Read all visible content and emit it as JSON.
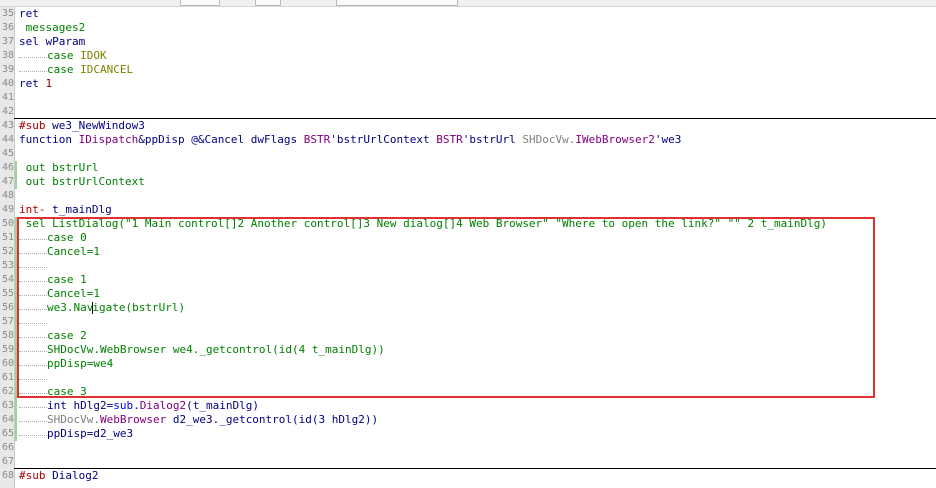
{
  "editor": {
    "lines": [
      {
        "num": "35",
        "indent": 0,
        "parts": [
          [
            "b",
            "ret"
          ]
        ]
      },
      {
        "num": "36",
        "indent": 0,
        "parts": [
          [
            "g",
            " messages2"
          ]
        ]
      },
      {
        "num": "37",
        "indent": 0,
        "parts": [
          [
            "b",
            "sel wParam"
          ]
        ]
      },
      {
        "num": "38",
        "indent": 1,
        "parts": [
          [
            "g",
            "case "
          ],
          [
            "c",
            "IDOK"
          ]
        ]
      },
      {
        "num": "39",
        "indent": 1,
        "parts": [
          [
            "g",
            "case "
          ],
          [
            "c",
            "IDCANCEL"
          ]
        ]
      },
      {
        "num": "40",
        "indent": 0,
        "parts": [
          [
            "b",
            "ret "
          ],
          [
            "n",
            "1"
          ]
        ]
      },
      {
        "num": "41",
        "indent": 0,
        "parts": []
      },
      {
        "num": "42",
        "indent": 0,
        "parts": []
      },
      {
        "num": "43",
        "indent": 0,
        "sep": true,
        "parts": [
          [
            "r",
            "#sub "
          ],
          [
            "b",
            "we3_NewWindow3"
          ]
        ]
      },
      {
        "num": "44",
        "indent": 0,
        "parts": [
          [
            "b",
            "function "
          ],
          [
            "m",
            "IDispatch"
          ],
          [
            "b",
            "&ppDisp @&Cancel dwFlags "
          ],
          [
            "m",
            "BSTR"
          ],
          [
            "b",
            "'bstrUrlContext "
          ],
          [
            "m",
            "BSTR"
          ],
          [
            "b",
            "'bstrUrl "
          ],
          [
            "gr",
            "SHDocVw."
          ],
          [
            "m",
            "IWebBrowser2"
          ],
          [
            "b",
            "'we3"
          ]
        ]
      },
      {
        "num": "45",
        "indent": 0,
        "parts": []
      },
      {
        "num": "46",
        "indent": 0,
        "mark": true,
        "parts": [
          [
            "g",
            " out bstrUrl"
          ]
        ]
      },
      {
        "num": "47",
        "indent": 0,
        "mark": true,
        "parts": [
          [
            "g",
            " out bstrUrlContext"
          ]
        ]
      },
      {
        "num": "48",
        "indent": 0,
        "parts": []
      },
      {
        "num": "49",
        "indent": 0,
        "parts": [
          [
            "r",
            "int- "
          ],
          [
            "b",
            "t_mainDlg"
          ]
        ]
      },
      {
        "num": "50",
        "indent": 0,
        "mark": true,
        "parts": [
          [
            "g",
            " sel ListDialog(\"1 Main control[]2 Another control[]3 New dialog[]4 Web Browser\" \"Where to open the link?\" \"\" 2 t_mainDlg)"
          ]
        ]
      },
      {
        "num": "51",
        "indent": 1,
        "mark": true,
        "parts": [
          [
            "g",
            "case 0"
          ]
        ]
      },
      {
        "num": "52",
        "indent": 1,
        "mark": true,
        "parts": [
          [
            "g",
            "Cancel=1"
          ]
        ]
      },
      {
        "num": "53",
        "indent": 1,
        "mark": true,
        "parts": []
      },
      {
        "num": "54",
        "indent": 1,
        "mark": true,
        "parts": [
          [
            "g",
            "case 1"
          ]
        ]
      },
      {
        "num": "55",
        "indent": 1,
        "mark": true,
        "parts": [
          [
            "g",
            "Cancel=1"
          ]
        ]
      },
      {
        "num": "56",
        "indent": 1,
        "mark": true,
        "cursor": true,
        "parts": [
          [
            "g",
            "we3.Nav"
          ],
          [
            "cur",
            ""
          ],
          [
            "g",
            "igate(bstrUrl)"
          ]
        ]
      },
      {
        "num": "57",
        "indent": 1,
        "mark": true,
        "parts": []
      },
      {
        "num": "58",
        "indent": 1,
        "mark": true,
        "parts": [
          [
            "g",
            "case 2"
          ]
        ]
      },
      {
        "num": "59",
        "indent": 1,
        "mark": true,
        "parts": [
          [
            "g",
            "SHDocVw.WebBrowser we4._getcontrol(id(4 t_mainDlg))"
          ]
        ]
      },
      {
        "num": "60",
        "indent": 1,
        "mark": true,
        "parts": [
          [
            "g",
            "ppDisp=we4"
          ]
        ]
      },
      {
        "num": "61",
        "indent": 1,
        "mark": true,
        "parts": []
      },
      {
        "num": "62",
        "indent": 1,
        "mark": true,
        "parts": [
          [
            "g",
            "case 3"
          ]
        ]
      },
      {
        "num": "63",
        "indent": 1,
        "mark": true,
        "parts": [
          [
            "b",
            "int hDlg2="
          ],
          [
            "k",
            "sub."
          ],
          [
            "m",
            "Dialog2"
          ],
          [
            "b",
            "(t_mainDlg)"
          ]
        ]
      },
      {
        "num": "64",
        "indent": 1,
        "mark": true,
        "parts": [
          [
            "gr",
            "SHDocVw."
          ],
          [
            "m",
            "WebBrowser"
          ],
          [
            "b",
            " d2_we3._getcontrol(id(3 hDlg2))"
          ]
        ]
      },
      {
        "num": "65",
        "indent": 1,
        "mark": true,
        "parts": [
          [
            "b",
            "ppDisp=d2_we3"
          ]
        ]
      },
      {
        "num": "66",
        "indent": 0,
        "parts": []
      },
      {
        "num": "67",
        "indent": 0,
        "parts": []
      },
      {
        "num": "68",
        "indent": 0,
        "sep": true,
        "parts": [
          [
            "r",
            "#sub "
          ],
          [
            "b",
            "Dialog2"
          ]
        ]
      }
    ]
  }
}
